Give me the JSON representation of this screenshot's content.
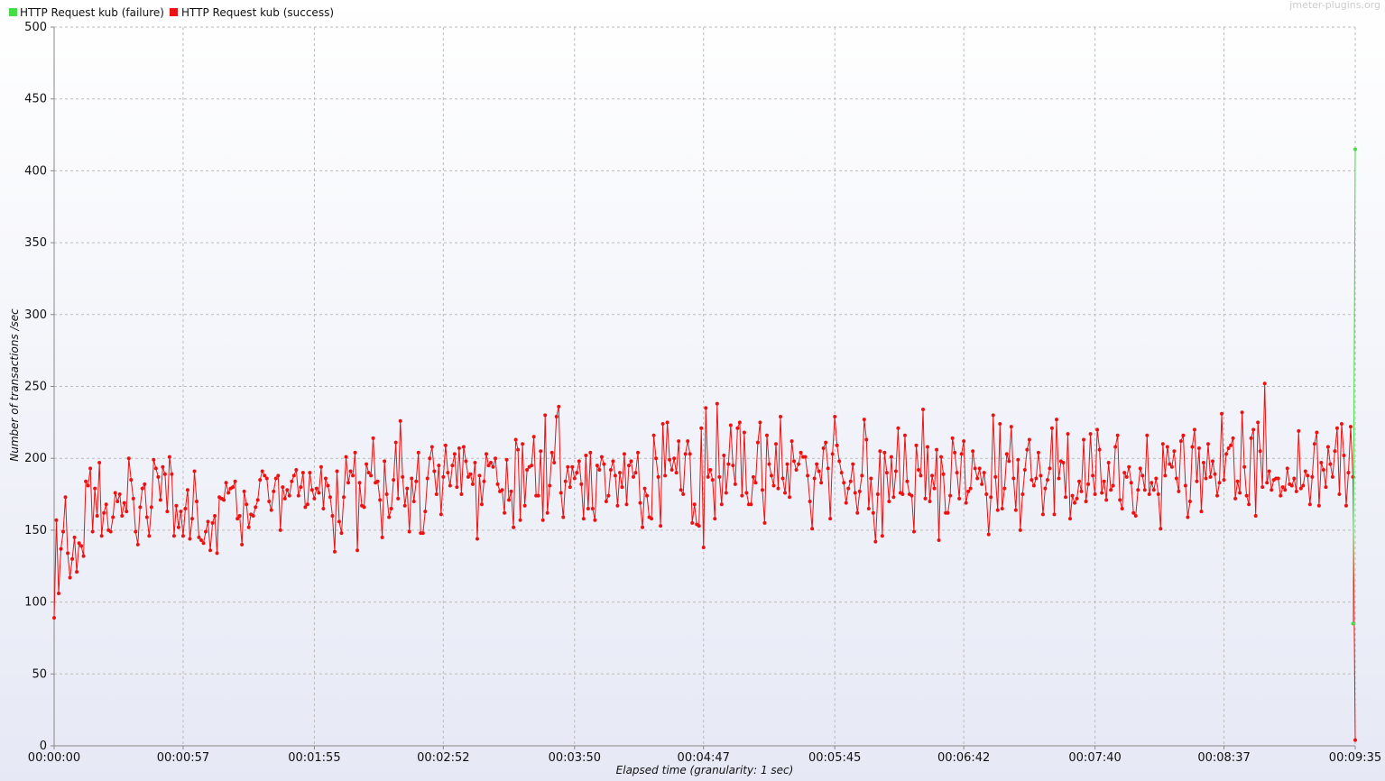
{
  "legend": [
    {
      "label": "HTTP Request kub (failure)",
      "color": "#44dd44"
    },
    {
      "label": "HTTP Request kub (success)",
      "color": "#ee1111"
    }
  ],
  "watermark": "jmeter-plugins.org",
  "chart_data": {
    "type": "line",
    "title": "",
    "xlabel": "Elapsed time (granularity: 1 sec)",
    "ylabel": "Number of transactions /sec",
    "ylim": [
      0,
      500
    ],
    "yticks": [
      0,
      50,
      100,
      150,
      200,
      250,
      300,
      350,
      400,
      450,
      500
    ],
    "xlim": [
      0,
      575
    ],
    "xticks": [
      {
        "t": 0,
        "label": "00:00:00"
      },
      {
        "t": 57,
        "label": "00:00:57"
      },
      {
        "t": 115,
        "label": "00:01:55"
      },
      {
        "t": 172,
        "label": "00:02:52"
      },
      {
        "t": 230,
        "label": "00:03:50"
      },
      {
        "t": 287,
        "label": "00:04:47"
      },
      {
        "t": 345,
        "label": "00:05:45"
      },
      {
        "t": 402,
        "label": "00:06:42"
      },
      {
        "t": 460,
        "label": "00:07:40"
      },
      {
        "t": 517,
        "label": "00:08:37"
      },
      {
        "t": 575,
        "label": "00:09:35"
      }
    ],
    "grid": true,
    "legend_position": "top-left",
    "series": [
      {
        "name": "HTTP Request kub (failure)",
        "color": "#44dd44",
        "x": [
          574,
          575
        ],
        "y": [
          85,
          415
        ]
      },
      {
        "name": "HTTP Request kub (success)",
        "color": "#ee1111",
        "x_start": 0,
        "x_step": 1,
        "y": [
          89,
          157,
          106,
          137,
          149,
          173,
          134,
          117,
          130,
          145,
          121,
          141,
          139,
          132,
          184,
          181,
          193,
          149,
          179,
          160,
          197,
          146,
          162,
          168,
          150,
          149,
          159,
          176,
          170,
          175,
          160,
          169,
          163,
          200,
          185,
          172,
          149,
          140,
          166,
          179,
          182,
          159,
          146,
          166,
          199,
          193,
          187,
          171,
          194,
          189,
          163,
          201,
          189,
          146,
          167,
          152,
          163,
          146,
          165,
          178,
          144,
          158,
          191,
          170,
          145,
          143,
          141,
          149,
          156,
          136,
          155,
          160,
          134,
          173,
          172,
          171,
          183,
          176,
          179,
          180,
          184,
          158,
          160,
          140,
          177,
          168,
          152,
          161,
          160,
          166,
          171,
          185,
          191,
          188,
          186,
          170,
          164,
          177,
          186,
          188,
          150,
          180,
          172,
          178,
          174,
          184,
          188,
          192,
          174,
          180,
          190,
          166,
          168,
          190,
          178,
          172,
          179,
          176,
          194,
          165,
          186,
          181,
          173,
          160,
          135,
          191,
          156,
          148,
          173,
          201,
          183,
          191,
          188,
          204,
          136,
          183,
          167,
          166,
          196,
          190,
          188,
          214,
          183,
          184,
          171,
          145,
          198,
          175,
          159,
          165,
          185,
          211,
          172,
          226,
          187,
          167,
          179,
          149,
          186,
          170,
          184,
          204,
          148,
          148,
          163,
          186,
          200,
          208,
          191,
          175,
          195,
          161,
          187,
          209,
          190,
          181,
          195,
          203,
          180,
          207,
          175,
          208,
          198,
          187,
          189,
          182,
          197,
          144,
          188,
          168,
          184,
          203,
          195,
          197,
          194,
          200,
          182,
          177,
          178,
          162,
          199,
          171,
          177,
          152,
          213,
          206,
          157,
          210,
          167,
          192,
          194,
          195,
          215,
          174,
          174,
          205,
          157,
          230,
          162,
          181,
          204,
          197,
          229,
          236,
          176,
          159,
          184,
          194,
          180,
          194,
          186,
          190,
          198,
          182,
          158,
          202,
          165,
          204,
          165,
          157,
          195,
          192,
          201,
          196,
          170,
          174,
          192,
          198,
          188,
          167,
          190,
          180,
          203,
          168,
          195,
          198,
          187,
          190,
          204,
          169,
          152,
          179,
          174,
          159,
          158,
          216,
          200,
          187,
          153,
          224,
          188,
          225,
          199,
          192,
          200,
          190,
          212,
          178,
          175,
          203,
          212,
          203,
          155,
          168,
          154,
          153,
          221,
          138,
          235,
          187,
          192,
          185,
          158,
          238,
          187,
          168,
          202,
          176,
          196,
          223,
          195,
          182,
          221,
          225,
          174,
          218,
          176,
          168,
          168,
          187,
          183,
          211,
          225,
          178,
          155,
          216,
          196,
          188,
          181,
          210,
          179,
          229,
          186,
          176,
          196,
          173,
          212,
          198,
          192,
          196,
          204,
          201,
          201,
          188,
          170,
          151,
          186,
          196,
          191,
          183,
          207,
          211,
          193,
          158,
          203,
          229,
          209,
          198,
          190,
          183,
          169,
          179,
          184,
          196,
          176,
          162,
          177,
          188,
          227,
          213,
          165,
          186,
          162,
          142,
          175,
          205,
          146,
          204,
          190,
          170,
          201,
          173,
          191,
          221,
          176,
          175,
          216,
          184,
          175,
          174,
          149,
          209,
          192,
          188,
          234,
          172,
          208,
          170,
          188,
          179,
          206,
          143,
          201,
          189,
          162,
          162,
          174,
          214,
          204,
          190,
          172,
          203,
          212,
          169,
          177,
          179,
          205,
          193,
          186,
          193,
          182,
          190,
          175,
          147,
          173,
          230,
          187,
          164,
          224,
          165,
          179,
          203,
          198,
          222,
          186,
          164,
          199,
          150,
          175,
          192,
          206,
          213,
          185,
          181,
          186,
          204,
          188,
          161,
          179,
          185,
          193,
          221,
          161,
          227,
          186,
          198,
          197,
          173,
          217,
          158,
          174,
          169,
          172,
          184,
          177,
          213,
          170,
          182,
          217,
          188,
          175,
          220,
          206,
          176,
          184,
          171,
          197,
          178,
          181,
          208,
          216,
          171,
          165,
          190,
          187,
          194,
          183,
          162,
          160,
          178,
          193,
          188,
          178,
          216,
          175,
          183,
          178,
          186,
          175,
          151,
          210,
          188,
          208,
          196,
          194,
          205,
          186,
          177,
          212,
          216,
          181,
          159,
          170,
          208,
          220,
          184,
          207,
          163,
          197,
          186,
          210,
          187,
          198,
          189,
          174,
          183,
          231,
          185,
          203,
          207,
          209,
          214,
          172,
          184,
          176,
          232,
          194,
          174,
          168,
          214,
          220,
          160,
          225,
          205,
          180,
          252,
          183,
          191,
          178,
          185,
          186,
          186,
          174,
          180,
          178,
          193,
          182,
          181,
          186,
          177,
          219,
          179,
          181,
          191,
          188,
          168,
          187,
          210,
          218,
          167,
          197,
          192,
          180,
          208,
          196,
          187,
          205,
          221,
          175,
          224,
          202,
          167,
          190,
          222,
          187,
          4
        ]
      }
    ]
  }
}
